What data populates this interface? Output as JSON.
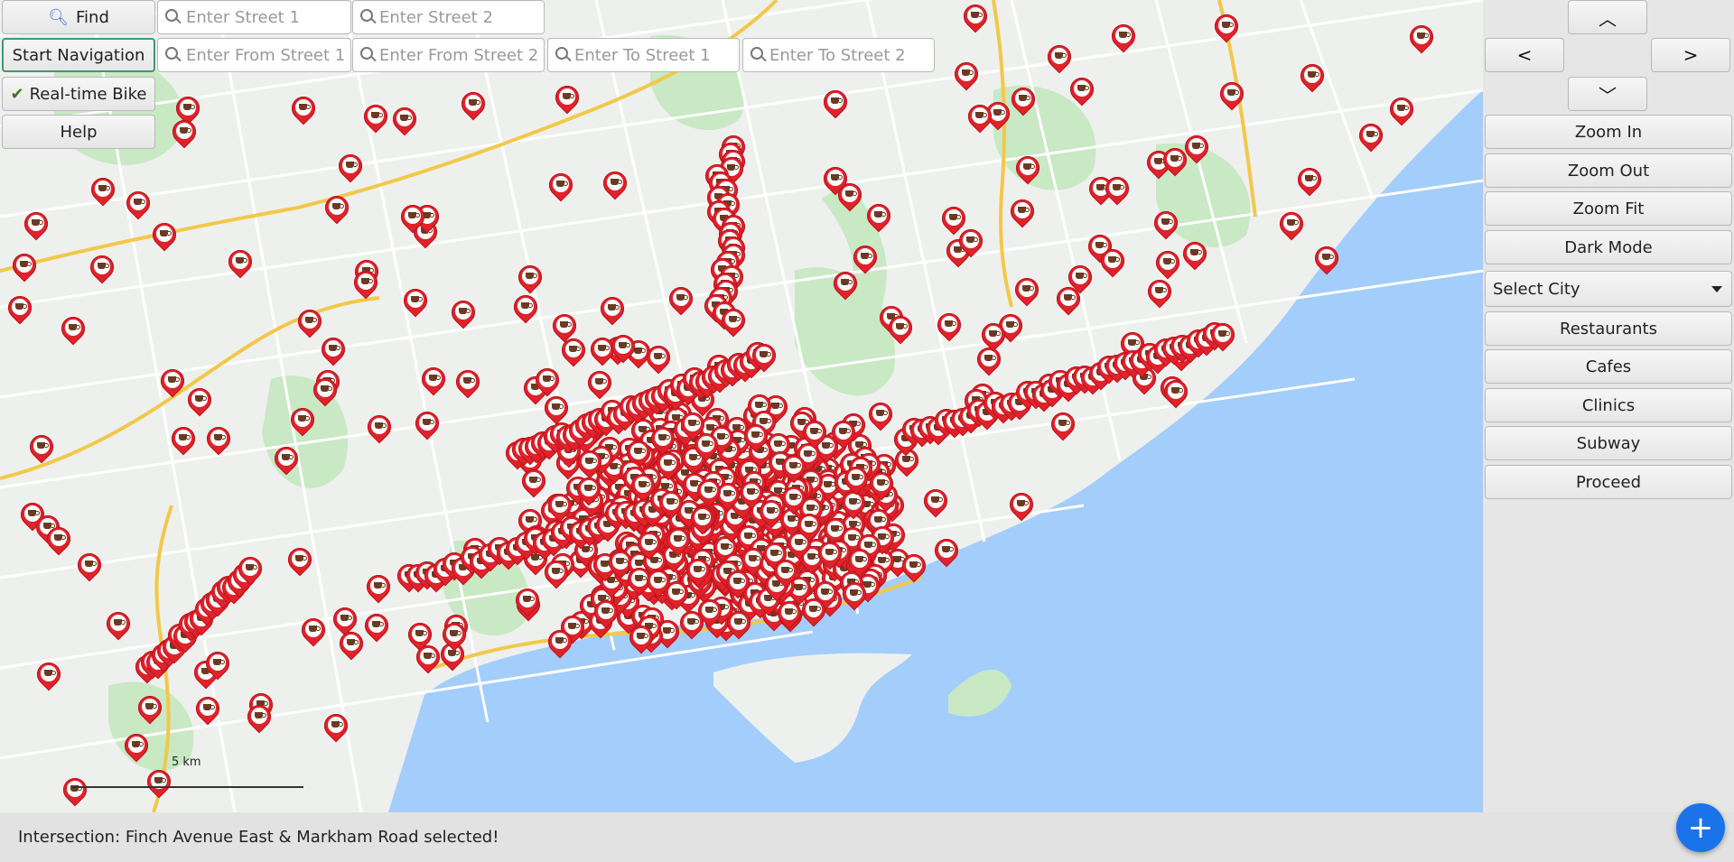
{
  "toolbar": {
    "find_label": "Find",
    "start_navigation_label": "Start Navigation",
    "realtime_bike_label": "Real-time Bike",
    "help_label": "Help",
    "street1_placeholder": "Enter Street 1",
    "street2_placeholder": "Enter Street 2",
    "from_street1_placeholder": "Enter From Street 1",
    "from_street2_placeholder": "Enter From Street 2",
    "to_street1_placeholder": "Enter To Street 1",
    "to_street2_placeholder": "Enter To Street 2",
    "find_icon": "search-icon",
    "realtime_icon": "checkmark-icon"
  },
  "panel": {
    "up_label": "⌃",
    "left_label": "<",
    "right_label": ">",
    "down_label": "⌄",
    "zoom_in_label": "Zoom In",
    "zoom_out_label": "Zoom Out",
    "zoom_fit_label": "Zoom Fit",
    "dark_mode_label": "Dark Mode",
    "select_city_label": "Select City",
    "restaurants_label": "Restaurants",
    "cafes_label": "Cafes",
    "clinics_label": "Clinics",
    "subway_label": "Subway",
    "proceed_label": "Proceed"
  },
  "map": {
    "scale_label": "5 km",
    "marker_icon": "cafe-icon",
    "colors": {
      "water": "#a3cdfb",
      "land": "#eef0ee",
      "park": "#c9e8c4",
      "highway": "#f2c84a",
      "marker": "#e0222b"
    }
  },
  "status": {
    "message": "Intersection: Finch Avenue East & Markham Road selected!"
  },
  "fab": {
    "label": "+"
  }
}
